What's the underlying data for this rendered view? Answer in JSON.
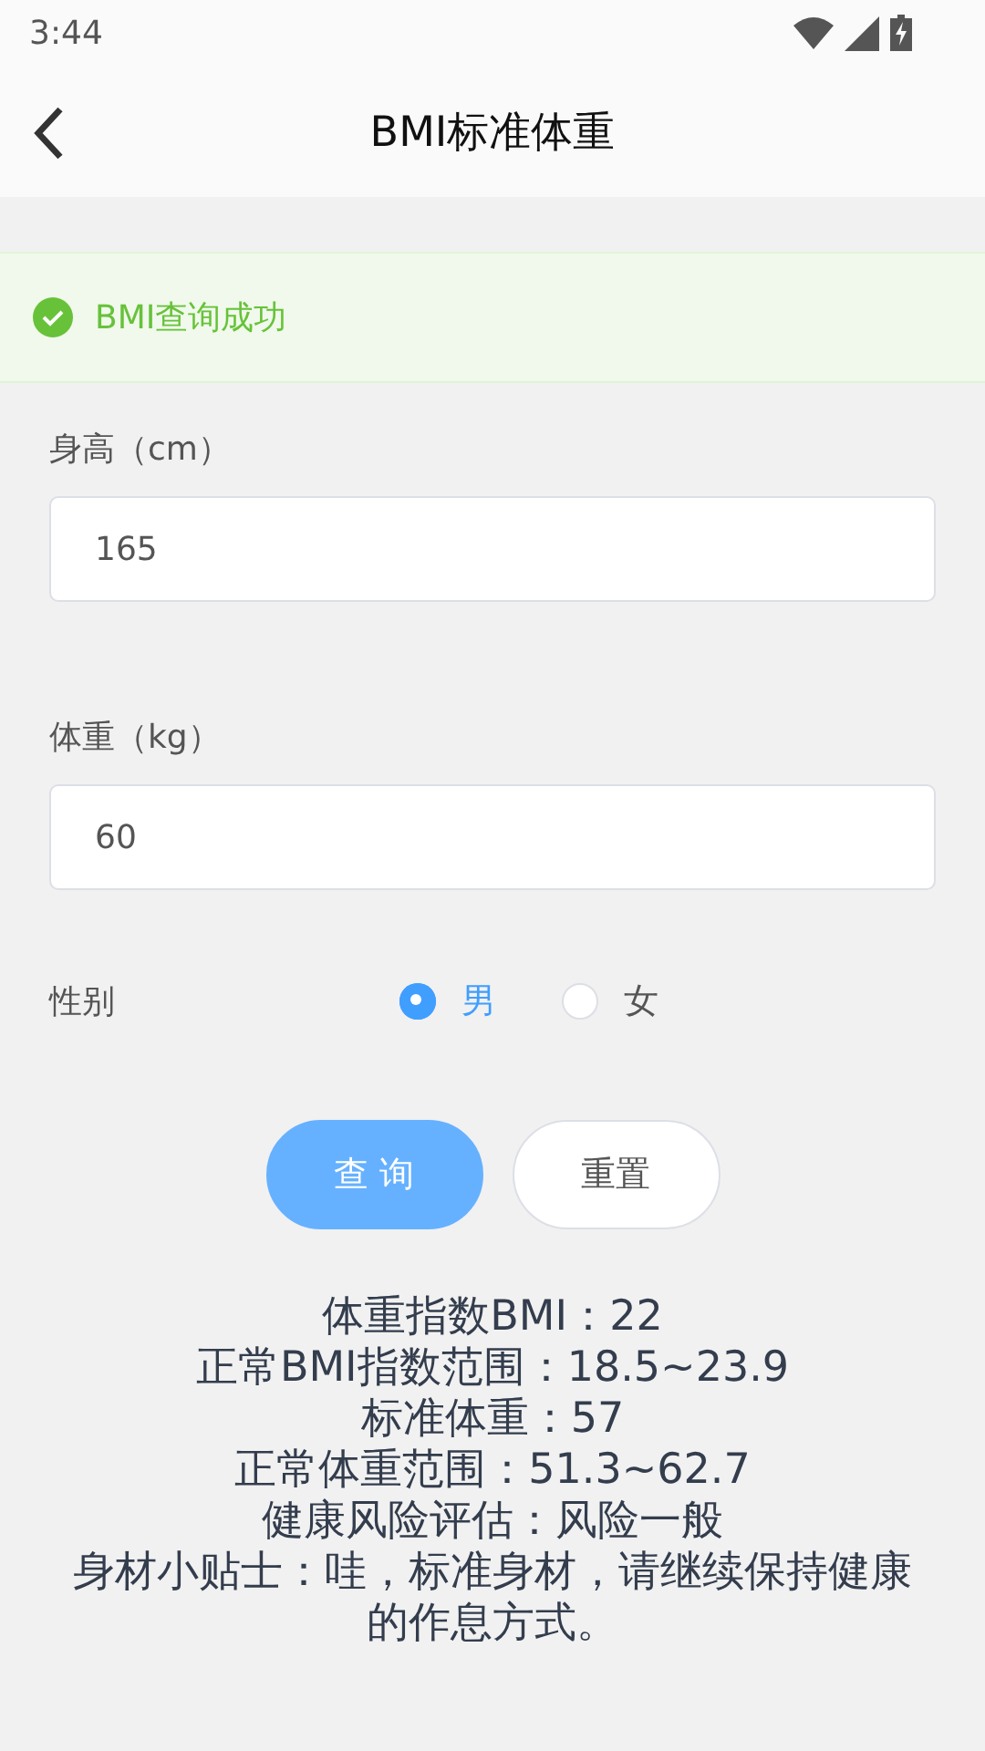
{
  "status_bar": {
    "time": "3:44"
  },
  "header": {
    "title": "BMI标准体重"
  },
  "alert": {
    "kind": "success",
    "message": "BMI查询成功"
  },
  "fields": [
    {
      "label": "身高（cm）",
      "value": "165"
    },
    {
      "label": "体重（kg）",
      "value": "60"
    }
  ],
  "gender": {
    "label": "性别",
    "options": [
      {
        "label": "男",
        "selected": true
      },
      {
        "label": "女",
        "selected": false
      }
    ]
  },
  "buttons": [
    {
      "label": "查 询",
      "kind": "primary"
    },
    {
      "label": "重置",
      "kind": "plain"
    }
  ],
  "results": [
    "体重指数BMI：22",
    "正常BMI指数范围：18.5~23.9",
    "标准体重：57",
    "正常体重范围：51.3~62.7",
    "健康风险评估：风险一般",
    "身材小贴士：哇，标准身材，请继续保持健康的作息方式。"
  ]
}
